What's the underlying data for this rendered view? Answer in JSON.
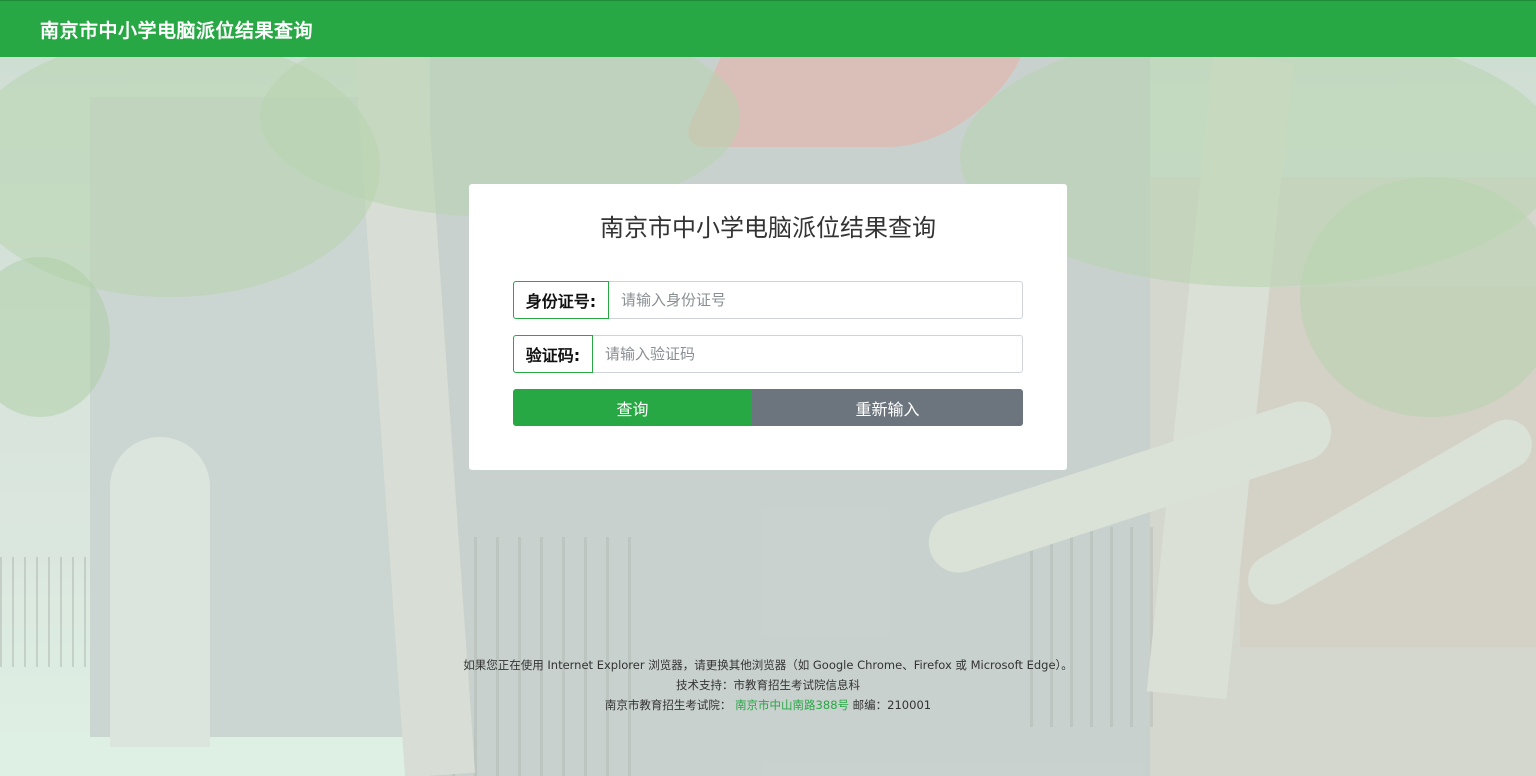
{
  "header": {
    "brand": "南京市中小学电脑派位结果查询"
  },
  "card": {
    "title": "南京市中小学电脑派位结果查询",
    "id_field": {
      "label": "身份证号:",
      "placeholder": "请输入身份证号",
      "value": ""
    },
    "captcha_field": {
      "label": "验证码:",
      "placeholder": "请输入验证码",
      "value": ""
    },
    "search_button": "查询",
    "reset_button": "重新输入"
  },
  "footer": {
    "browser_notice": "如果您正在使用 Internet Explorer 浏览器，请更换其他浏览器（如 Google Chrome、Firefox 或 Microsoft Edge）。",
    "tech_support": "技术支持：市教育招生考试院信息科",
    "org_name": "南京市教育招生考试院：",
    "address": "南京市中山南路388号",
    "postcode": "邮编：210001"
  },
  "colors": {
    "brand": "#28a745",
    "reset": "#6c757d"
  }
}
